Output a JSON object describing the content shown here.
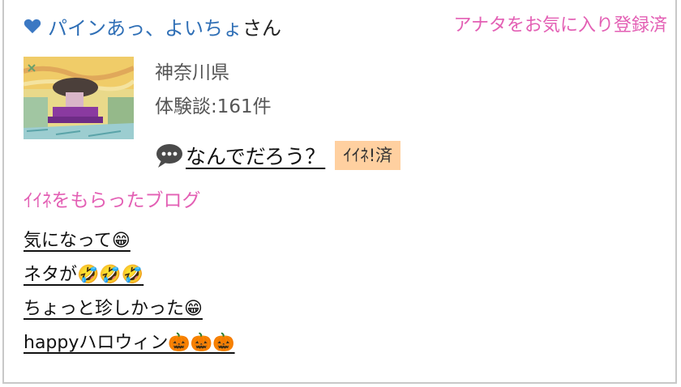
{
  "header": {
    "user_name": "パインあっ、よいちょ",
    "honorific": "さん",
    "favorite_status": "アナタをお気に入り登録済"
  },
  "profile": {
    "region": "神奈川県",
    "posts_count": "体験談:161件"
  },
  "latest_post": {
    "title": "なんでだろう？",
    "iine_label": "ｲｲﾈ!済"
  },
  "liked_blogs": {
    "title": "ｲｲﾈをもらったブログ",
    "items": [
      "気になって😁",
      "ネタが🤣🤣🤣",
      "ちょっと珍しかった😁",
      "happyハロウィン🎃🎃🎃"
    ]
  },
  "colors": {
    "user_name": "#2f6fb6",
    "accent_pink": "#e35fb4",
    "iine_badge_bg": "#ffd0a0"
  },
  "icons": [
    "heart-icon",
    "speech-bubble-icon"
  ]
}
